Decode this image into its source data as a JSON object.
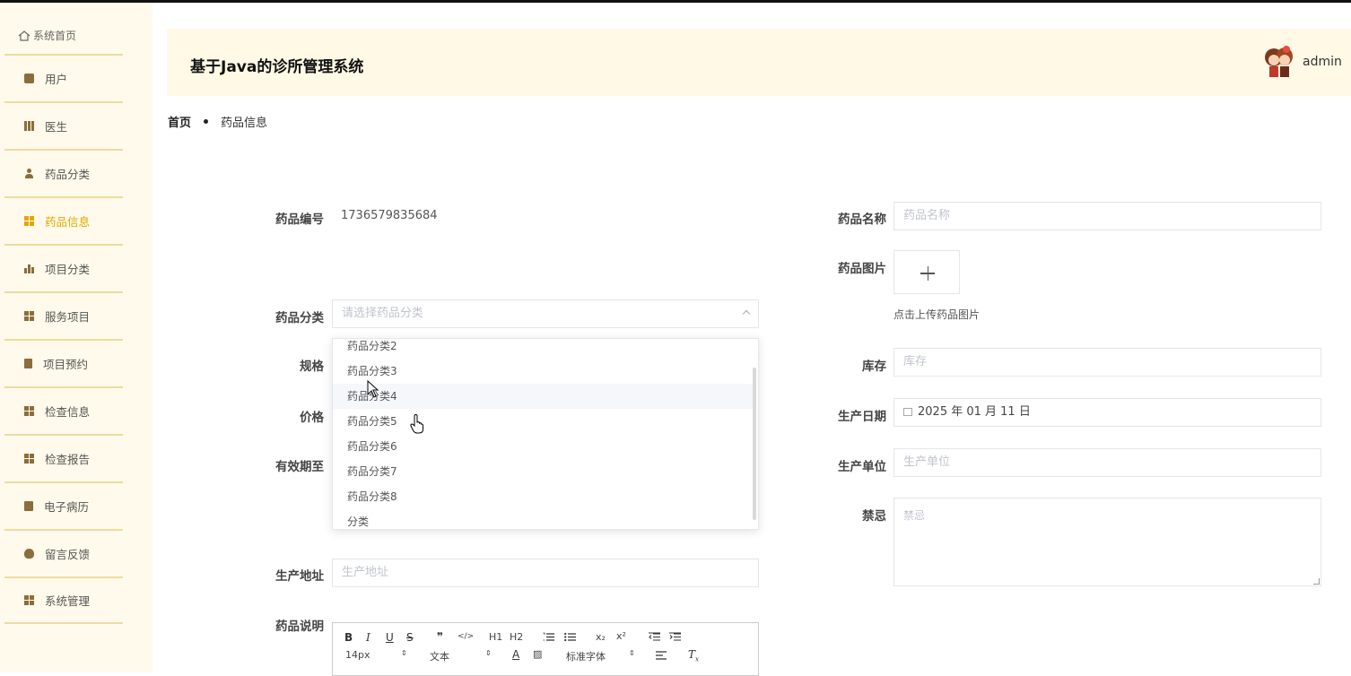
{
  "sidebar": {
    "home_label": "系统首页",
    "items": [
      {
        "label": "用户",
        "icon": "chat-icon"
      },
      {
        "label": "医生",
        "icon": "bars-icon"
      },
      {
        "label": "药品分类",
        "icon": "user-icon"
      },
      {
        "label": "药品信息",
        "icon": "grid-icon",
        "active": true
      },
      {
        "label": "项目分类",
        "icon": "chart-icon"
      },
      {
        "label": "服务项目",
        "icon": "grid-icon"
      },
      {
        "label": "项目预约",
        "icon": "clipboard-icon"
      },
      {
        "label": "检查信息",
        "icon": "grid-icon"
      },
      {
        "label": "检查报告",
        "icon": "grid-icon"
      },
      {
        "label": "电子病历",
        "icon": "checklist-icon"
      },
      {
        "label": "留言反馈",
        "icon": "bulb-icon"
      },
      {
        "label": "系统管理",
        "icon": "grid-icon"
      }
    ]
  },
  "header": {
    "title": "基于Java的诊所管理系统",
    "username": "admin"
  },
  "breadcrumb": {
    "home": "首页",
    "current": "药品信息"
  },
  "form": {
    "code_label": "药品编号",
    "code_value": "1736579835684",
    "name_label": "药品名称",
    "name_placeholder": "药品名称",
    "image_label": "药品图片",
    "image_hint": "点击上传药品图片",
    "category_label": "药品分类",
    "category_placeholder": "请选择药品分类",
    "spec_label": "规格",
    "stock_label": "库存",
    "stock_placeholder": "库存",
    "price_label": "价格",
    "date_label": "生产日期",
    "date_value": "2025 年 01 月 11 日",
    "expiry_label": "有效期至",
    "maker_label": "生产单位",
    "maker_placeholder": "生产单位",
    "taboo_label": "禁忌",
    "taboo_placeholder": "禁忌",
    "address_label": "生产地址",
    "address_placeholder": "生产地址",
    "desc_label": "药品说明"
  },
  "dropdown": {
    "options": [
      "药品分类2",
      "药品分类3",
      "药品分类4",
      "药品分类5",
      "药品分类6",
      "药品分类7",
      "药品分类8",
      "分类"
    ],
    "hovered_index": 2
  },
  "editor": {
    "toolbar_row1": [
      "B",
      "I",
      "U",
      "S",
      "❞",
      "</>",
      "H1",
      "H2",
      "ordered-list",
      "bullet-list",
      "x₂",
      "x²",
      "outdent",
      "indent"
    ],
    "font_size": "14px",
    "block_type": "文本",
    "font_family": "标准字体"
  },
  "colors": {
    "sidebar_bg": "#fffaeb",
    "header_bg": "#fff9e6",
    "accent": "#e0a800",
    "divider": "#eedb9f"
  }
}
